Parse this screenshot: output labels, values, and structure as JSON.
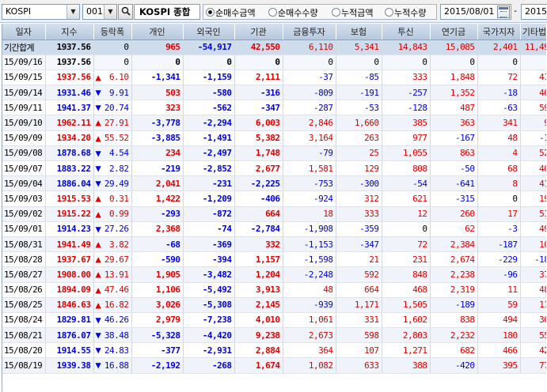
{
  "toolbar": {
    "market_value": "KOSPI",
    "code_value": "001",
    "index_name": "KOSPI 종합",
    "radios": [
      {
        "label": "순매수금액",
        "checked": true
      },
      {
        "label": "순매수수량",
        "checked": false
      },
      {
        "label": "누적금액",
        "checked": false
      },
      {
        "label": "누적수량",
        "checked": false
      }
    ],
    "start_date": "2015/08/01",
    "range_sep": "-",
    "end_date": "2015"
  },
  "table": {
    "headers": [
      "일자",
      "지수",
      "등락폭",
      "개인",
      "외국인",
      "기관",
      "금융투자",
      "보험",
      "투신",
      "연기금",
      "국가지자",
      "기타법인"
    ],
    "summary": {
      "date": "기간합계",
      "index": "1937.56",
      "change": "0",
      "dir": "flat",
      "values": [
        "965",
        "-54,917",
        "42,550",
        "6,110",
        "5,341",
        "14,843",
        "15,085",
        "2,401",
        "11,491"
      ]
    },
    "current": {
      "date": "15/09/16",
      "index": "1937.56",
      "change": "0",
      "dir": "flat",
      "values": [
        "0",
        "0",
        "0",
        "0",
        "0",
        "0",
        "0",
        "0",
        "0"
      ]
    },
    "rows": [
      {
        "date": "15/09/15",
        "index": "1937.56",
        "change": "6.10",
        "dir": "up",
        "values": [
          "-1,341",
          "-1,159",
          "2,111",
          "-37",
          "-85",
          "333",
          "1,848",
          "72",
          "413"
        ]
      },
      {
        "date": "15/09/14",
        "index": "1931.46",
        "change": "9.91",
        "dir": "down",
        "values": [
          "503",
          "-580",
          "-316",
          "-809",
          "-191",
          "-257",
          "1,352",
          "-18",
          "409"
        ]
      },
      {
        "date": "15/09/11",
        "index": "1941.37",
        "change": "20.74",
        "dir": "down",
        "values": [
          "323",
          "-562",
          "-347",
          "-287",
          "-53",
          "-128",
          "487",
          "-63",
          "590"
        ]
      },
      {
        "date": "15/09/10",
        "index": "1962.11",
        "change": "27.91",
        "dir": "up",
        "values": [
          "-3,778",
          "-2,294",
          "6,003",
          "2,846",
          "1,660",
          "385",
          "363",
          "341",
          "97"
        ]
      },
      {
        "date": "15/09/09",
        "index": "1934.20",
        "change": "55.52",
        "dir": "up",
        "values": [
          "-3,885",
          "-1,491",
          "5,382",
          "3,164",
          "263",
          "977",
          "-167",
          "48",
          "-19"
        ]
      },
      {
        "date": "15/09/08",
        "index": "1878.68",
        "change": "4.54",
        "dir": "down",
        "values": [
          "234",
          "-2,497",
          "1,748",
          "-79",
          "25",
          "1,055",
          "863",
          "4",
          "522"
        ]
      },
      {
        "date": "15/09/07",
        "index": "1883.22",
        "change": "2.82",
        "dir": "down",
        "values": [
          "-219",
          "-2,852",
          "2,677",
          "1,581",
          "129",
          "808",
          "-50",
          "68",
          "409"
        ]
      },
      {
        "date": "15/09/04",
        "index": "1886.04",
        "change": "29.49",
        "dir": "down",
        "values": [
          "2,041",
          "-231",
          "-2,225",
          "-753",
          "-300",
          "-54",
          "-641",
          "8",
          "414"
        ]
      },
      {
        "date": "15/09/03",
        "index": "1915.53",
        "change": "0.31",
        "dir": "up",
        "values": [
          "1,422",
          "-1,209",
          "-406",
          "-924",
          "312",
          "621",
          "-315",
          "0",
          "194"
        ]
      },
      {
        "date": "15/09/02",
        "index": "1915.22",
        "change": "0.99",
        "dir": "up",
        "values": [
          "-293",
          "-872",
          "664",
          "18",
          "333",
          "12",
          "260",
          "17",
          "513"
        ]
      },
      {
        "date": "15/09/01",
        "index": "1914.23",
        "change": "27.26",
        "dir": "down",
        "values": [
          "2,368",
          "-74",
          "-2,784",
          "-1,908",
          "-359",
          "0",
          "62",
          "-3",
          "492"
        ]
      },
      {
        "date": "15/08/31",
        "index": "1941.49",
        "change": "3.82",
        "dir": "up",
        "values": [
          "-68",
          "-369",
          "332",
          "-1,153",
          "-347",
          "72",
          "2,384",
          "-187",
          "103"
        ]
      },
      {
        "date": "15/08/28",
        "index": "1937.67",
        "change": "29.67",
        "dir": "up",
        "values": [
          "-590",
          "-394",
          "1,157",
          "-1,598",
          "21",
          "231",
          "2,674",
          "-229",
          "-183"
        ]
      },
      {
        "date": "15/08/27",
        "index": "1908.00",
        "change": "13.91",
        "dir": "up",
        "values": [
          "1,905",
          "-3,482",
          "1,204",
          "-2,248",
          "592",
          "848",
          "2,238",
          "-96",
          "373"
        ]
      },
      {
        "date": "15/08/26",
        "index": "1894.09",
        "change": "47.46",
        "dir": "up",
        "values": [
          "1,106",
          "-5,492",
          "3,913",
          "48",
          "664",
          "468",
          "2,319",
          "11",
          "485"
        ]
      },
      {
        "date": "15/08/25",
        "index": "1846.63",
        "change": "16.82",
        "dir": "up",
        "values": [
          "3,026",
          "-5,308",
          "2,145",
          "-939",
          "1,171",
          "1,505",
          "-189",
          "59",
          "115"
        ]
      },
      {
        "date": "15/08/24",
        "index": "1829.81",
        "change": "46.26",
        "dir": "down",
        "values": [
          "2,979",
          "-7,238",
          "4,010",
          "1,061",
          "331",
          "1,602",
          "838",
          "494",
          "300"
        ]
      },
      {
        "date": "15/08/21",
        "index": "1876.07",
        "change": "38.48",
        "dir": "down",
        "values": [
          "-5,328",
          "-4,420",
          "9,238",
          "2,673",
          "598",
          "2,803",
          "2,232",
          "180",
          "553"
        ]
      },
      {
        "date": "15/08/20",
        "index": "1914.55",
        "change": "24.83",
        "dir": "down",
        "values": [
          "-377",
          "-2,931",
          "2,884",
          "364",
          "107",
          "1,271",
          "682",
          "466",
          "429"
        ]
      },
      {
        "date": "15/08/19",
        "index": "1939.38",
        "change": "16.88",
        "dir": "down",
        "values": [
          "-2,192",
          "-268",
          "1,674",
          "1,082",
          "633",
          "388",
          "-420",
          "395",
          "774"
        ]
      }
    ]
  },
  "colors": {
    "up": "#e00000",
    "down": "#0000e0",
    "header_bg": "#bcccdf",
    "summary_bg": "#cfdcec"
  },
  "icons": {
    "dropdown": "chevron-down-icon",
    "search": "search-icon",
    "calendar": "calendar-icon",
    "up_arrow": "triangle-up-icon",
    "down_arrow": "triangle-down-icon"
  }
}
